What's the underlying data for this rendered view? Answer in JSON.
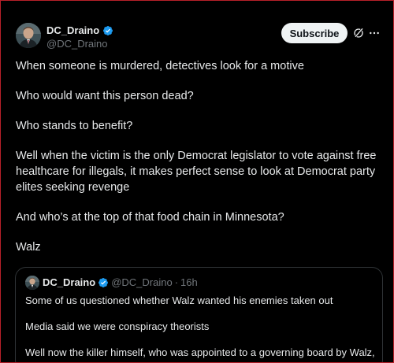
{
  "tweet": {
    "author": {
      "display_name": "DC_Draino",
      "handle": "@DC_Draino",
      "verified": true
    },
    "subscribe_label": "Subscribe",
    "icons": {
      "avatar": "avatar",
      "verified": "verified-badge-icon",
      "grok": "grok-icon",
      "more": "more-icon"
    },
    "paragraphs": [
      "When someone is murdered, detectives look for a motive",
      "Who would want this person dead?",
      "Who stands to benefit?",
      "Well when the victim is the only Democrat legislator to vote against free healthcare for illegals, it makes perfect sense to look at Democrat party elites seeking revenge",
      "And who’s at the top of that food chain in Minnesota?",
      "Walz"
    ]
  },
  "quote": {
    "display_name": "DC_Draino",
    "handle": "@DC_Draino",
    "separator": "·",
    "time": "16h",
    "paragraphs": [
      "Some of us questioned whether Walz wanted his enemies taken out",
      "Media said we were conspiracy theorists",
      "Well now the killer himself, who was appointed to a governing board by Walz, ..."
    ]
  },
  "colors": {
    "background": "#000000",
    "text": "#e7e9ea",
    "muted": "#71767b",
    "verified": "#1d9bf0",
    "border": "#2f3336",
    "button_bg": "#eff3f4"
  }
}
